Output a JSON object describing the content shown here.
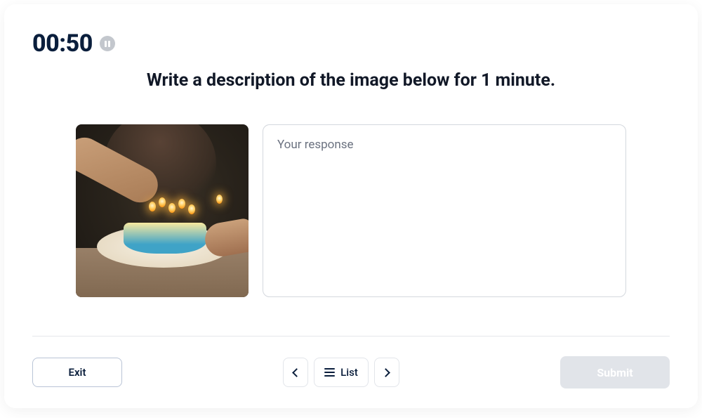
{
  "timer": {
    "display": "00:50"
  },
  "prompt": {
    "title": "Write a description of the image below for 1 minute."
  },
  "response": {
    "placeholder": "Your response",
    "value": ""
  },
  "footer": {
    "exit_label": "Exit",
    "list_label": "List",
    "submit_label": "Submit",
    "submit_enabled": false
  },
  "stimulus": {
    "alt": "A person lighting candles on a birthday cake in a dim room"
  }
}
